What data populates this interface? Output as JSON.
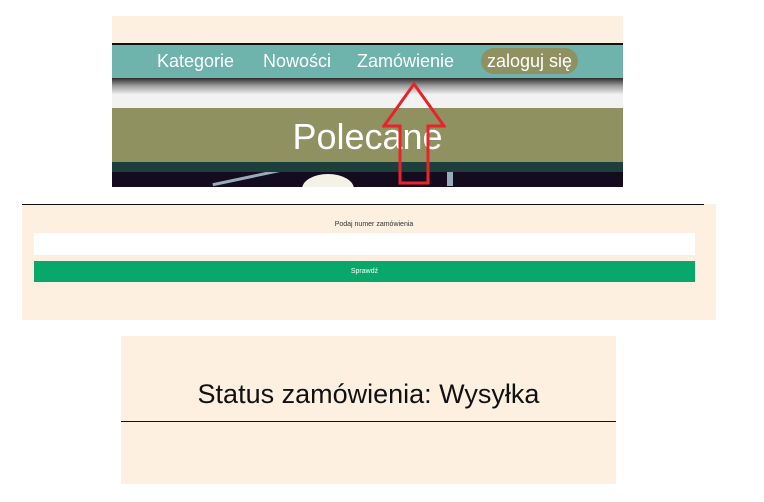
{
  "nav": {
    "items": [
      "Kategorie",
      "Nowości",
      "Zamówienie"
    ],
    "login_label": "zaloguj się",
    "section_title": "Polecane"
  },
  "annotation": {
    "arrow_color": "#e8232a"
  },
  "order_form": {
    "label": "Podaj numer zamówienia",
    "input_value": "",
    "button_label": "Sprawdź",
    "button_color": "#08a86a"
  },
  "status": {
    "text": "Status zamówienia: Wysyłka"
  },
  "colors": {
    "panel_background": "#fdf0e1",
    "navbar": "#6fb3ad",
    "accent_olive": "#8f9161"
  }
}
